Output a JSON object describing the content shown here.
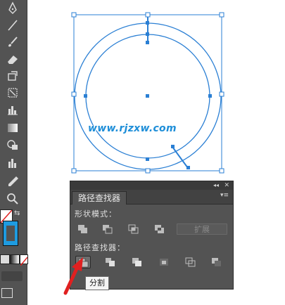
{
  "toolbar": {
    "tools": [
      "pen-tool",
      "line-tool",
      "brush-tool",
      "eraser-tool",
      "rotate-tool",
      "free-transform-tool",
      "graph-tool",
      "gradient-tool",
      "shape-builder-tool",
      "column-graph-tool",
      "eyedropper-tool",
      "zoom-tool"
    ]
  },
  "canvas": {
    "watermark": "www.rjzxw.com",
    "accent_color": "#2a7fd4"
  },
  "pathfinder_panel": {
    "title": "路径查找器",
    "shape_modes_label": "形状模式：",
    "shape_modes": [
      "unite",
      "minus-front",
      "intersect",
      "exclude"
    ],
    "expand_label": "扩展",
    "pathfinders_label": "路径查找器：",
    "pathfinders": [
      "divide",
      "trim",
      "merge",
      "crop",
      "outline",
      "minus-back"
    ],
    "tooltip": "分割"
  },
  "colors": {
    "panel_bg": "#535353",
    "toolbar_bg": "#535353",
    "selection": "#2a7fd4",
    "arrow": "#e02020",
    "stroke_swatch": "#1e9be0"
  }
}
